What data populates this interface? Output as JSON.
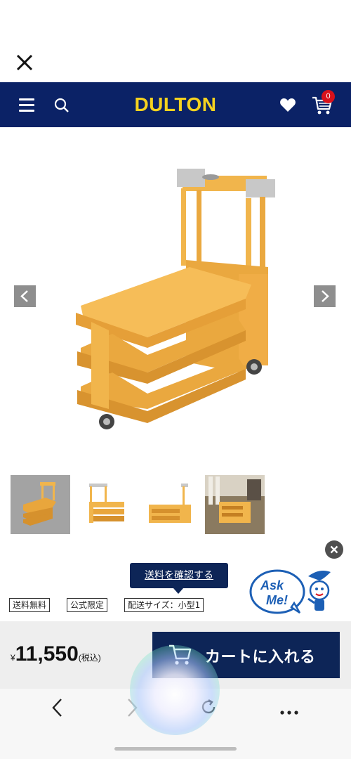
{
  "header": {
    "logo": "DULTON",
    "cart_count": "0",
    "icons": [
      "menu-icon",
      "search-icon",
      "heart-icon",
      "cart-icon"
    ]
  },
  "gallery": {
    "thumbnail_count": 4,
    "selected_index": 0
  },
  "tooltip": {
    "label": "送料を確認する"
  },
  "tags": [
    "送料無料",
    "公式限定",
    "配送サイズ：小型1"
  ],
  "askme": {
    "line1": "Ask",
    "line2": "Me!"
  },
  "price": {
    "currency": "¥",
    "amount": "11,550",
    "tax_note": "(税込)"
  },
  "cart_button": {
    "label": "カートに入れる"
  },
  "colors": {
    "brand_navy": "#0b2266",
    "logo_yellow": "#f5d21f",
    "product_mustard": "#f1b54c",
    "badge_red": "#d8111b"
  }
}
